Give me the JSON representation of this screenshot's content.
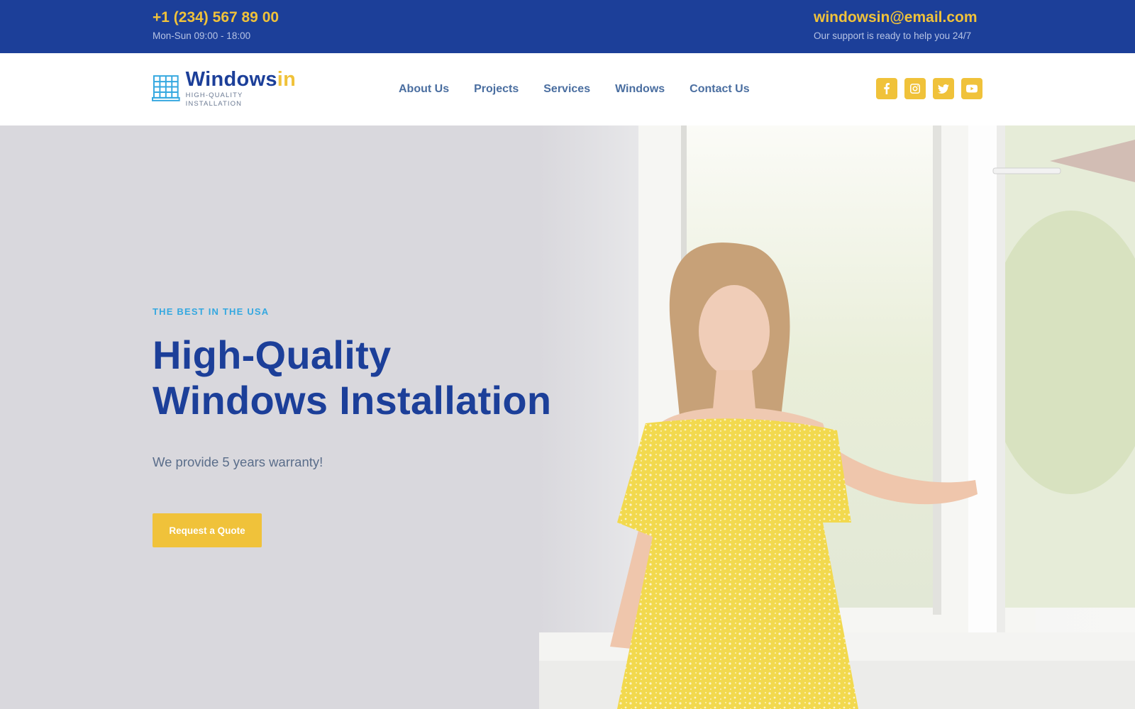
{
  "topbar": {
    "phone": "+1 (234) 567 89 00",
    "hours": "Mon-Sun 09:00 - 18:00",
    "email": "windowsin@email.com",
    "support": "Our support is ready to help you 24/7"
  },
  "header": {
    "logo": {
      "name_main": "Windows",
      "name_accent": "in",
      "tagline": "HIGH-QUALITY INSTALLATION",
      "icon": "window-icon"
    },
    "nav": [
      {
        "label": "About Us"
      },
      {
        "label": "Projects"
      },
      {
        "label": "Services"
      },
      {
        "label": "Windows"
      },
      {
        "label": "Contact Us"
      }
    ],
    "social": [
      {
        "icon": "facebook-icon"
      },
      {
        "icon": "instagram-icon"
      },
      {
        "icon": "twitter-icon"
      },
      {
        "icon": "youtube-icon"
      }
    ]
  },
  "hero": {
    "eyebrow": "THE BEST IN THE USA",
    "headline_line1": "High-Quality",
    "headline_line2": "Windows Installation",
    "subline": "We provide 5 years warranty!",
    "cta_label": "Request a Quote",
    "image_alt": "Smiling woman in yellow dress opening a white window"
  },
  "colors": {
    "primary": "#1c3f99",
    "accent": "#f0c23a",
    "eyebrow": "#35a8e0",
    "nav_text": "#4a6ea0",
    "hero_bg": "#d9d8dd"
  }
}
